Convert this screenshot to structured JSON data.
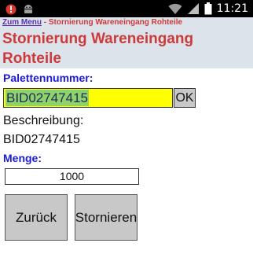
{
  "status_bar": {
    "time": "11:21",
    "icons": [
      "alert-icon",
      "android-icon",
      "wifi-icon",
      "signal-icon",
      "battery-icon"
    ]
  },
  "header": {
    "menu_link": "Zum Menu",
    "separator": " - ",
    "breadcrumb_title": "Stornierung Wareneingang Rohteile",
    "title": "Stornierung Wareneingang Rohteile",
    "background": "#dde3ea",
    "title_color": "#cc3a3a",
    "link_color": "#5b2fb3"
  },
  "form": {
    "pallet_label": "Palettennummer:",
    "pallet_value": "BID02747415",
    "ok_label": "OK",
    "description_label": "Beschreibung:",
    "description_value": "BID02747415",
    "quantity_label": "Menge:",
    "quantity_value": "1000",
    "label_color": "#1b1bd6",
    "input_highlight": "#ffff00"
  },
  "buttons": {
    "back_label": "Zurück",
    "cancel_label": "Stornieren"
  }
}
